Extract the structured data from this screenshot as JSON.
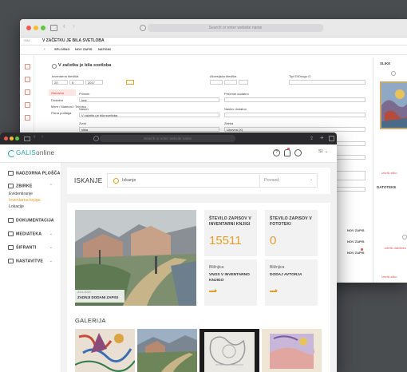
{
  "back_window": {
    "url_placeholder": "Search or enter website name",
    "record_title": "V ZAČETKU JE BILA SVETLOBA",
    "tabs": [
      "SPLOŠNO",
      "NOV ZAPIS",
      "NATISNI"
    ],
    "form_title": "V začetku je bila svetloba",
    "inventory_label": "Inventarna številka",
    "inventory_parts": [
      "20",
      "5",
      "2017"
    ],
    "acquisition_label": "Akcesijska številka",
    "type_label": "Tipi Ei/Drugo G.",
    "sub_tabs": [
      "Osnovno",
      "Dodatno",
      "Mere / Material / Tehnika",
      "Pisna podlaga"
    ],
    "fields": [
      {
        "label": "Priimek",
        "value": "Ime"
      },
      {
        "label": "Naslov",
        "value": "V začetku je bila svetloba"
      },
      {
        "label": "Zvrst",
        "value": "slika"
      },
      {
        "label": "Predmet dodatno",
        "value": ""
      },
      {
        "label": "Naslov dodatno",
        "value": ""
      },
      {
        "label": "Zbirka",
        "value": "Likovna (X)"
      }
    ],
    "panel_slike": "SLIKE",
    "panel_datoteke": "DATOTEKE",
    "side_buttons": [
      "NOV ZAPIS",
      "NOV ZAPIS",
      "NOV ZAPIS"
    ],
    "remove_labels": [
      "Izbriši sliko",
      "Izbriši sliko",
      "Izbriši datoteko"
    ]
  },
  "front_window": {
    "url_placeholder": "Search or enter website name",
    "app": {
      "brand_prefix": "GALIS",
      "brand_suffix": "online",
      "lang": "SI"
    },
    "sidebar": {
      "items": [
        {
          "label": "NADZORNA PLOŠČA"
        },
        {
          "label": "ZBIRKE"
        },
        {
          "label": "DOKUMENTACIJA"
        },
        {
          "label": "MEDIATEKA"
        },
        {
          "label": "ŠIFRANTI"
        },
        {
          "label": "NASTAVITVE"
        }
      ],
      "sub_items": [
        "Evidentiranje",
        "Inventarna knjiga",
        "Lokacije"
      ]
    },
    "search": {
      "title": "ISKANJE",
      "placeholder": "Iskanje",
      "select_value": "Povsod"
    },
    "featured": {
      "date": "23.5.2022",
      "caption": "ZADNJI DODANI ZAPISI"
    },
    "stats": [
      {
        "title": "ŠTEVILO ZAPISOV V INVENTARNI KNJIGI",
        "value": "15511"
      },
      {
        "title": "ŠTEVILO ZAPISOV V FOTOTEKI",
        "value": "0"
      }
    ],
    "shortcuts": [
      {
        "prefix": "Bližnjica",
        "title": "VNOS V INVENTARNO KNJIGO"
      },
      {
        "prefix": "Bližnjica",
        "title": "DODAJ AVTORJA"
      }
    ],
    "gallery_title": "GALERIJA"
  },
  "colors": {
    "accent": "#e0a12c",
    "brand_teal": "#1f9bb2",
    "danger": "#d9534f"
  }
}
